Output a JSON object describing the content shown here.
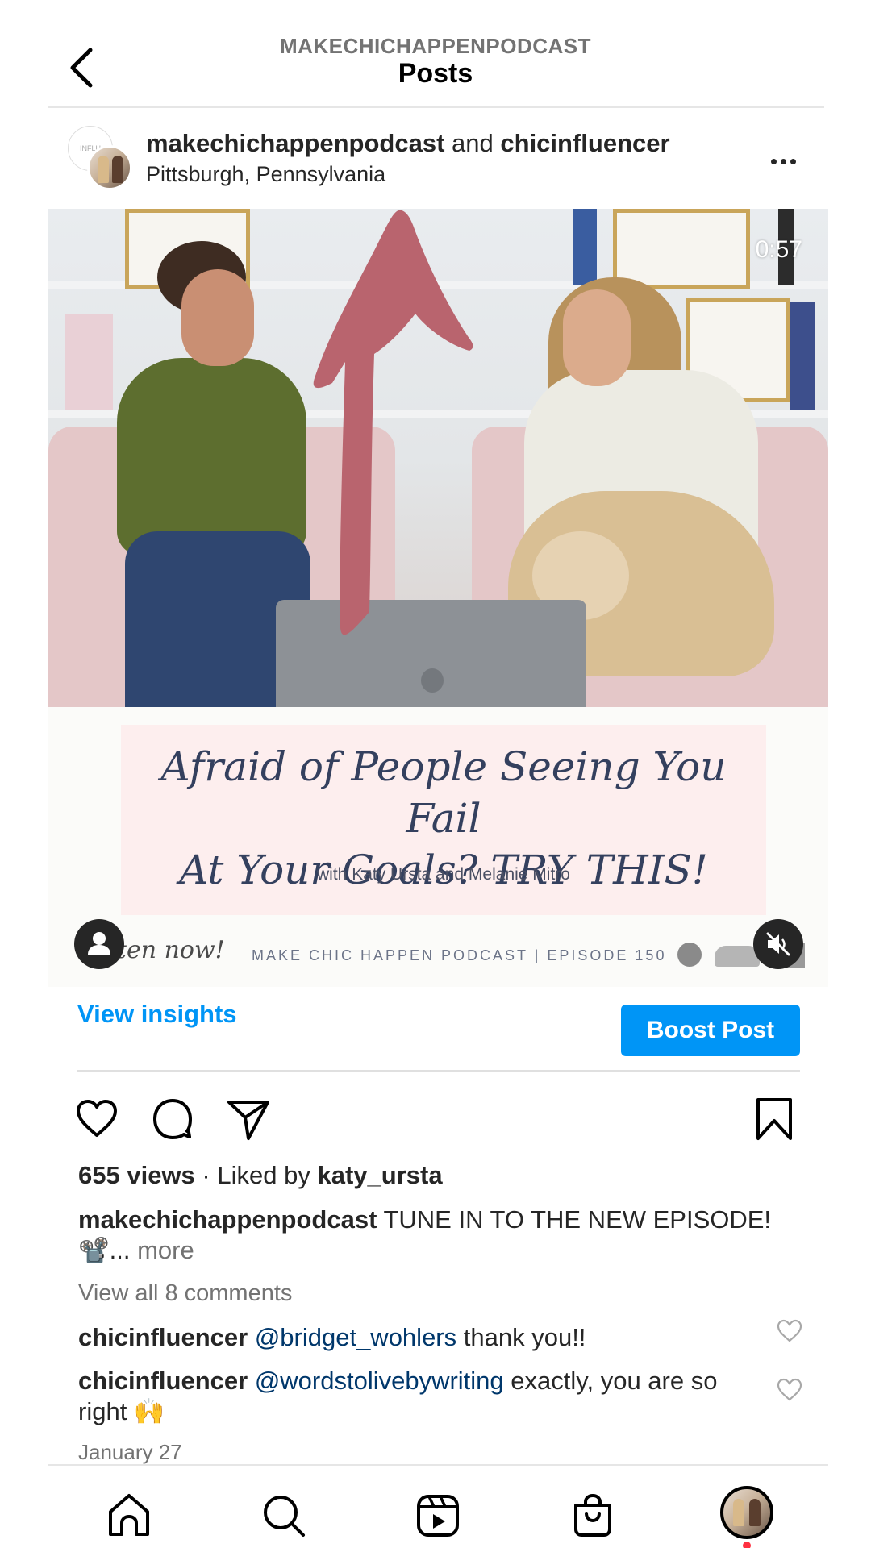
{
  "header": {
    "account": "MAKECHICHAPPENPODCAST",
    "title": "Posts"
  },
  "post": {
    "author": "makechichappenpodcast",
    "joiner": "and",
    "collaborator": "chicinfluencer",
    "location": "Pittsburgh, Pennsylvania",
    "collab_avatar_text": "INFLU",
    "video": {
      "time_remaining": "0:57",
      "banner_title_line1": "Afraid of People Seeing You Fail",
      "banner_title_line2": "At Your Goals? TRY THIS!",
      "banner_subtitle": "with Katy Ursta and Melanie Mitro",
      "listen_now": "Listen now!",
      "episode_line": "MAKE CHIC HAPPEN PODCAST | EPISODE 150",
      "muted": true,
      "annotation_color": "#b9646e"
    },
    "insights_label": "View insights",
    "boost_label": "Boost Post",
    "views": "655 views",
    "separator": "·",
    "liked_by_prefix": "Liked by",
    "liked_by_user": "katy_ursta",
    "caption_user": "makechichappenpodcast",
    "caption_text": "TUNE IN TO THE NEW EPISODE!📽️...",
    "caption_more": "more",
    "view_all_comments": "View all 8 comments",
    "comments": [
      {
        "user": "chicinfluencer",
        "mention": "@bridget_wohlers",
        "text": "thank you!!"
      },
      {
        "user": "chicinfluencer",
        "mention": "@wordstolivebywriting",
        "text": "exactly, you are so right 🙌"
      }
    ],
    "date": "January 27"
  },
  "tabbar": {
    "items": [
      "home",
      "search",
      "reels",
      "shop",
      "profile"
    ],
    "notification_color": "#ff3040"
  },
  "colors": {
    "accent": "#0095f6",
    "mention": "#00376b",
    "secondary_text": "#737373"
  }
}
